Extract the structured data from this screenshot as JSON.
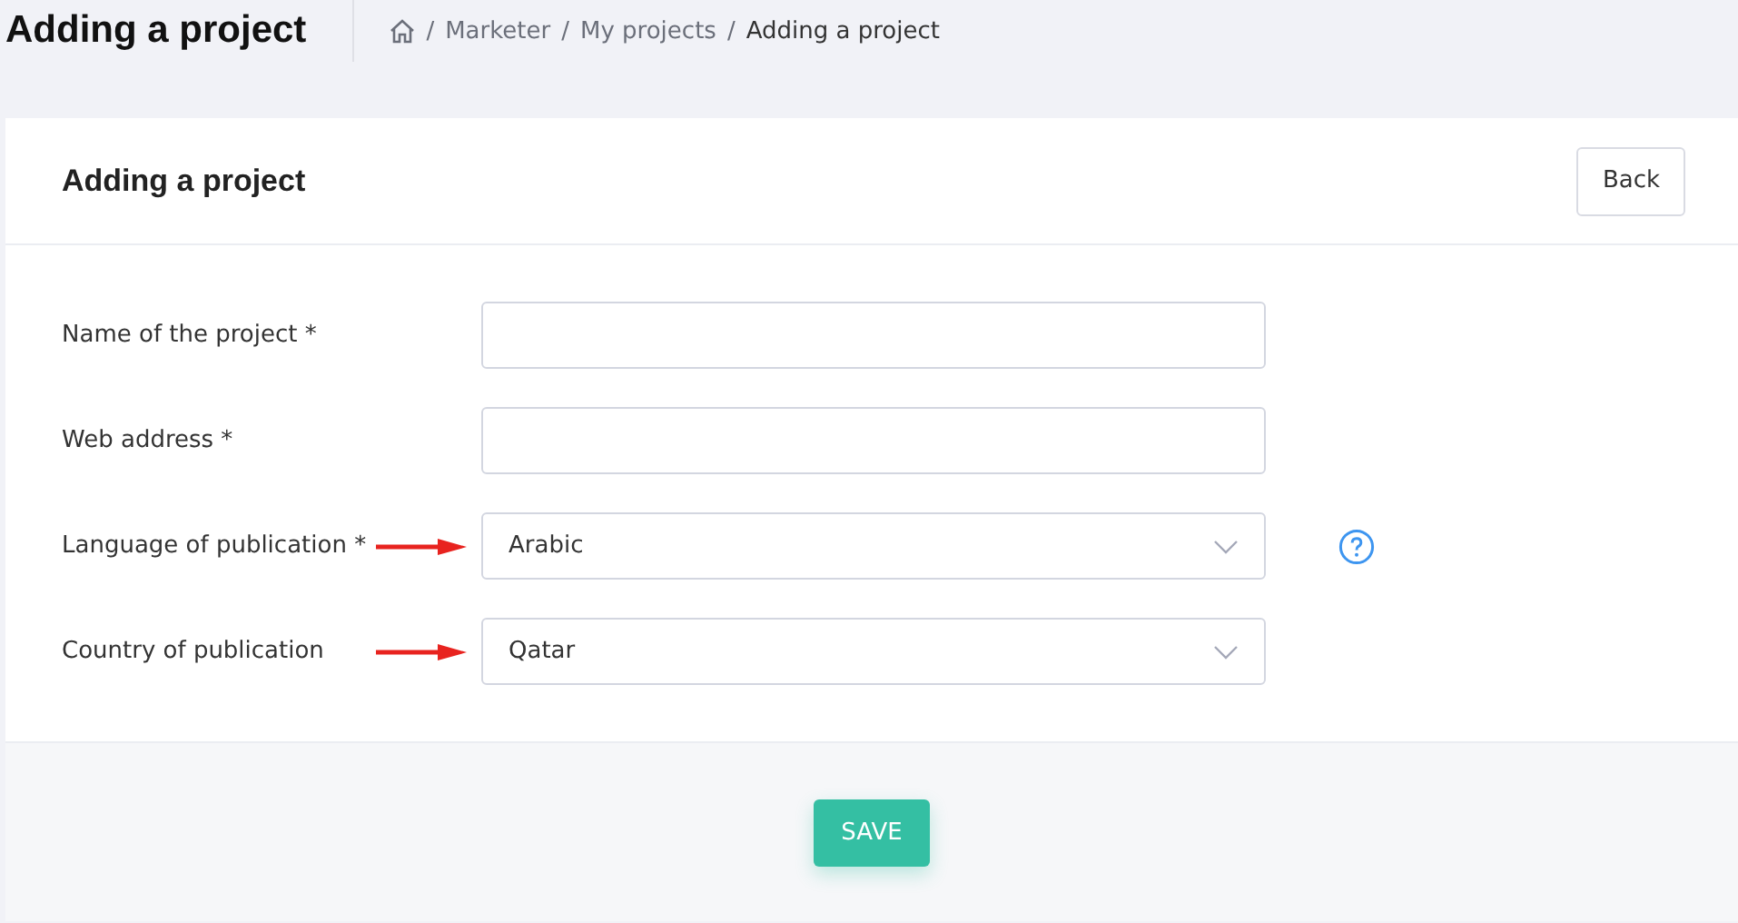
{
  "page_title": "Adding a project",
  "breadcrumbs": [
    {
      "separator": "/",
      "label": "Marketer",
      "current": false
    },
    {
      "separator": "/",
      "label": "My projects",
      "current": false
    },
    {
      "separator": "/",
      "label": "Adding a project",
      "current": true
    }
  ],
  "card": {
    "title": "Adding a project",
    "back_button": "Back"
  },
  "fields": [
    {
      "label": "Name of the project *",
      "kind": "text",
      "arrow": false,
      "help": false
    },
    {
      "label": "Web address *",
      "kind": "text",
      "arrow": false,
      "help": false
    },
    {
      "label": "Language of publication *",
      "kind": "select",
      "value": "Arabic",
      "arrow": true,
      "help": true
    },
    {
      "label": "Country of publication",
      "kind": "select",
      "value": "Qatar",
      "arrow": true,
      "help": false
    }
  ],
  "save_button": "SAVE"
}
